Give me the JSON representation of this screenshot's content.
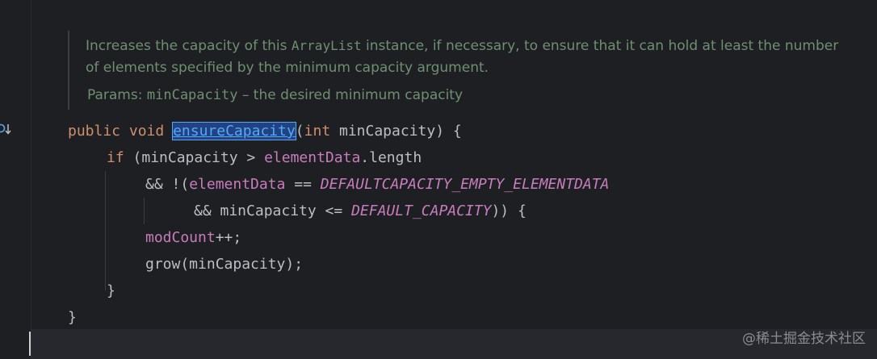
{
  "doc": {
    "desc_part1": "Increases the capacity of this ",
    "desc_code": "ArrayList",
    "desc_part2": " instance, if necessary, to ensure that it can hold at least the number of elements specified by the minimum capacity argument.",
    "params_label": "Params:",
    "param_name": "minCapacity",
    "param_desc": " – the desired minimum capacity"
  },
  "code": {
    "l1_kw_public": "public",
    "l1_kw_void": "void",
    "l1_method": "ensureCapacity",
    "l1_open": "(",
    "l1_kw_int": "int",
    "l1_rest": " minCapacity) {",
    "l2_kw_if": "if",
    "l2_text": " (minCapacity > ",
    "l2_field": "elementData",
    "l2_length": ".length",
    "l3_text1": "&& !(",
    "l3_field": "elementData",
    "l3_text2": " == ",
    "l3_const": "DEFAULTCAPACITY_EMPTY_ELEMENTDATA",
    "l4_text1": "&& minCapacity <= ",
    "l4_const": "DEFAULT_CAPACITY",
    "l4_text2": ")) {",
    "l5_field": "modCount",
    "l5_text": "++;",
    "l6_text": "grow(minCapacity);",
    "l7_text": "}",
    "l8_text": "}"
  },
  "watermark": "@稀土掘金技术社区",
  "colors": {
    "background": "#1e1f22",
    "keyword": "#cf8e6d",
    "field": "#c77dbb",
    "method_declaration": "#56a8f5",
    "doc_text": "#6f8f72",
    "default_text": "#bcbec4"
  }
}
